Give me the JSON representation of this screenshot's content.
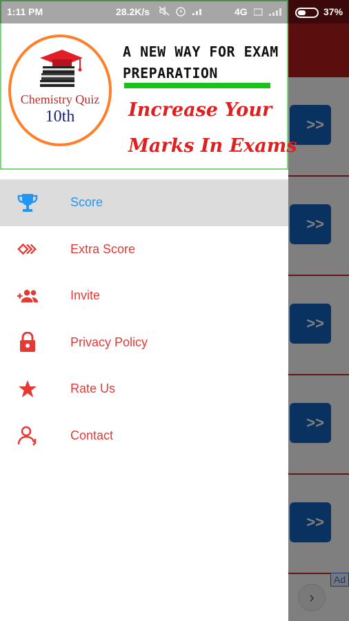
{
  "status_bar": {
    "time": "1:11 PM",
    "network_speed": "28.2K/s",
    "network_type": "4G",
    "battery_percent": "37%"
  },
  "background": {
    "row_button_label": ">>",
    "ad_label": "Ad",
    "next_icon": "chevron-right-icon"
  },
  "drawer": {
    "logo": {
      "title": "Chemistry Quiz",
      "grade": "10th",
      "icon": "graduation-cap-books-icon"
    },
    "tagline": "A NEW WAY FOR EXAM PREPARATION",
    "tagline_line1": "A NEW WAY FOR EXAM",
    "tagline_line2": "PREPARATION",
    "slogan_line1": "Increase Your",
    "slogan_line2": "Marks In Exams",
    "colors": {
      "header_border": "#7cd67c",
      "logo_ring": "#ff7f2a",
      "accent_red": "#e53935",
      "active_blue": "#2196f3",
      "active_bg": "#dcdcdc"
    },
    "menu": [
      {
        "label": "Score",
        "icon": "trophy-icon",
        "active": true
      },
      {
        "label": "Extra Score",
        "icon": "double-chevron-icon",
        "active": false
      },
      {
        "label": "Invite",
        "icon": "add-people-icon",
        "active": false
      },
      {
        "label": "Privacy Policy",
        "icon": "lock-icon",
        "active": false
      },
      {
        "label": "Rate Us",
        "icon": "star-icon",
        "active": false
      },
      {
        "label": "Contact",
        "icon": "person-contact-icon",
        "active": false
      }
    ]
  }
}
